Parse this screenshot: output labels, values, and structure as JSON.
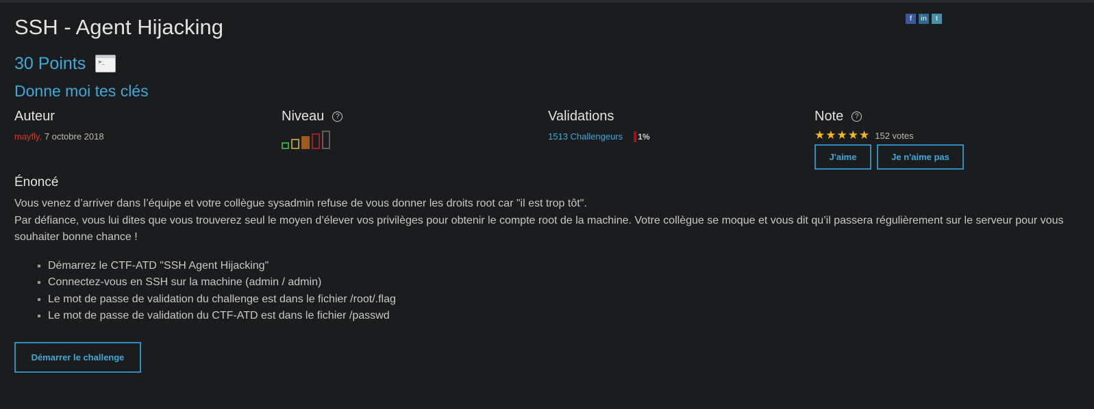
{
  "challenge": {
    "title": "SSH - Agent Hijacking",
    "points": "30 Points",
    "category_icon": "terminal-icon",
    "subtitle": "Donne moi tes clés"
  },
  "share": {
    "icons": [
      "facebook-icon",
      "linkedin-icon",
      "twitter-icon"
    ]
  },
  "meta": {
    "author": {
      "label": "Auteur",
      "name": "mayfly,",
      "date": "7 octobre 2018"
    },
    "level": {
      "label": "Niveau",
      "help_icon": "?",
      "difficulty_level": 3,
      "max_level": 5
    },
    "validations": {
      "label": "Validations",
      "challengers": "1513 Challengeurs",
      "percent": "1%"
    },
    "note": {
      "label": "Note",
      "help_icon": "?",
      "stars": 5,
      "votes": "152 votes",
      "like_button": "J'aime",
      "dislike_button": "Je n'aime pas"
    }
  },
  "statement": {
    "title": "Énoncé",
    "line1": "Vous venez d’arriver dans l’équipe et votre collègue sysadmin refuse de vous donner les droits root car \"il est trop tôt\".",
    "line2": "Par défiance, vous lui dites que vous trouverez seul le moyen d’élever vos privilèges pour obtenir le compte root de la machine. Votre collègue se moque et vous dit qu’il passera régulièrement sur le serveur pour vous souhaiter bonne chance !",
    "items": [
      "Démarrez le CTF-ATD \"SSH Agent Hijacking\"",
      "Connectez-vous en SSH sur la machine (admin / admin)",
      "Le mot de passe de validation du challenge est dans le fichier /root/.flag",
      "Le mot de passe de validation du CTF-ATD est dans le fichier /passwd"
    ],
    "start_button": "Démarrer le challenge"
  },
  "colors": {
    "accent": "#3fa9d8",
    "author": "#d33a2c",
    "background": "#1b1c1e",
    "star": "#f3b81f"
  }
}
